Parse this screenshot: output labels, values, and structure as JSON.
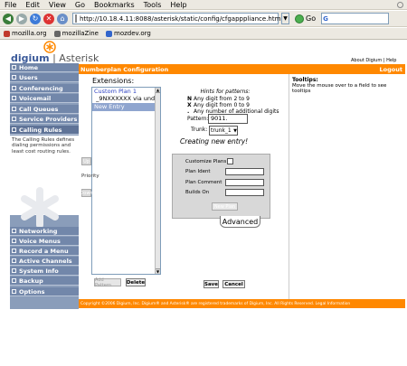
{
  "browser": {
    "menu": [
      "File",
      "Edit",
      "View",
      "Go",
      "Bookmarks",
      "Tools",
      "Help"
    ],
    "url": "http://10.18.4.11:8088/asterisk/static/config/cfgapppliance.html",
    "go_label": "Go",
    "search_value": "G",
    "bookmarks": [
      {
        "label": "mozilla.org",
        "icon_color": "#c0392b"
      },
      {
        "label": "mozillaZine",
        "icon_color": "#666666"
      },
      {
        "label": "mozdev.org",
        "icon_color": "#3366cc"
      }
    ]
  },
  "brand": {
    "logo": "digium",
    "product": "Asterisk",
    "about": "About Digium | Help",
    "accent": "#ff8800",
    "nav_bg": "#7287aa"
  },
  "nav": {
    "top": [
      "Home",
      "Users",
      "Conferencing",
      "Voicemail",
      "Call Queues",
      "Service Providers",
      "Calling Rules"
    ],
    "bottom": [
      "Networking",
      "Voice Menus",
      "Record a Menu",
      "Active Channels",
      "System Info",
      "Backup",
      "Options"
    ],
    "selected": "Calling Rules",
    "calling_rules_info": "The Calling Rules defines dialing permissions and least cost routing rules."
  },
  "header": {
    "title": "Numberplan Configuration",
    "logout": "Logout"
  },
  "extensions": {
    "label": "Extensions:",
    "items": [
      "Custom Plan 1",
      "_9NXXXXXX via undefi",
      "New Entry"
    ],
    "selected_index": 2,
    "priority_label": "Priority",
    "up": "Up",
    "down": "Down",
    "add": "Add Pattern",
    "delete": "Delete"
  },
  "hints": {
    "title": "Hints for patterns:",
    "rows": [
      {
        "key": "N",
        "text": "Any digit from 2 to 9"
      },
      {
        "key": "X",
        "text": "Any digit from 0 to 9"
      },
      {
        "key": ".",
        "text": "Any number of additional digits"
      }
    ]
  },
  "form": {
    "pattern_label": "Pattern:",
    "pattern_value": "9011.",
    "trunk_label": "Trunk:",
    "trunk_value": "trunk_1",
    "status": "Creating new entry!"
  },
  "advanced": {
    "customize_label": "Customize Plans",
    "plan_ident": "Plan Ident",
    "plan_comment": "Plan Comment",
    "builds_on": "Builds On",
    "new_plan": "New Plan",
    "tab": "Advanced"
  },
  "actions": {
    "save": "Save",
    "cancel": "Cancel"
  },
  "tooltips": {
    "title": "Tooltips:",
    "text": "Move the mouse over to a field to see tooltips"
  },
  "footer": "Copyright ©2006 Digium, Inc. Digium® and Asterisk® are registered trademarks of Digium, Inc. All Rights Reserved. Legal Information"
}
